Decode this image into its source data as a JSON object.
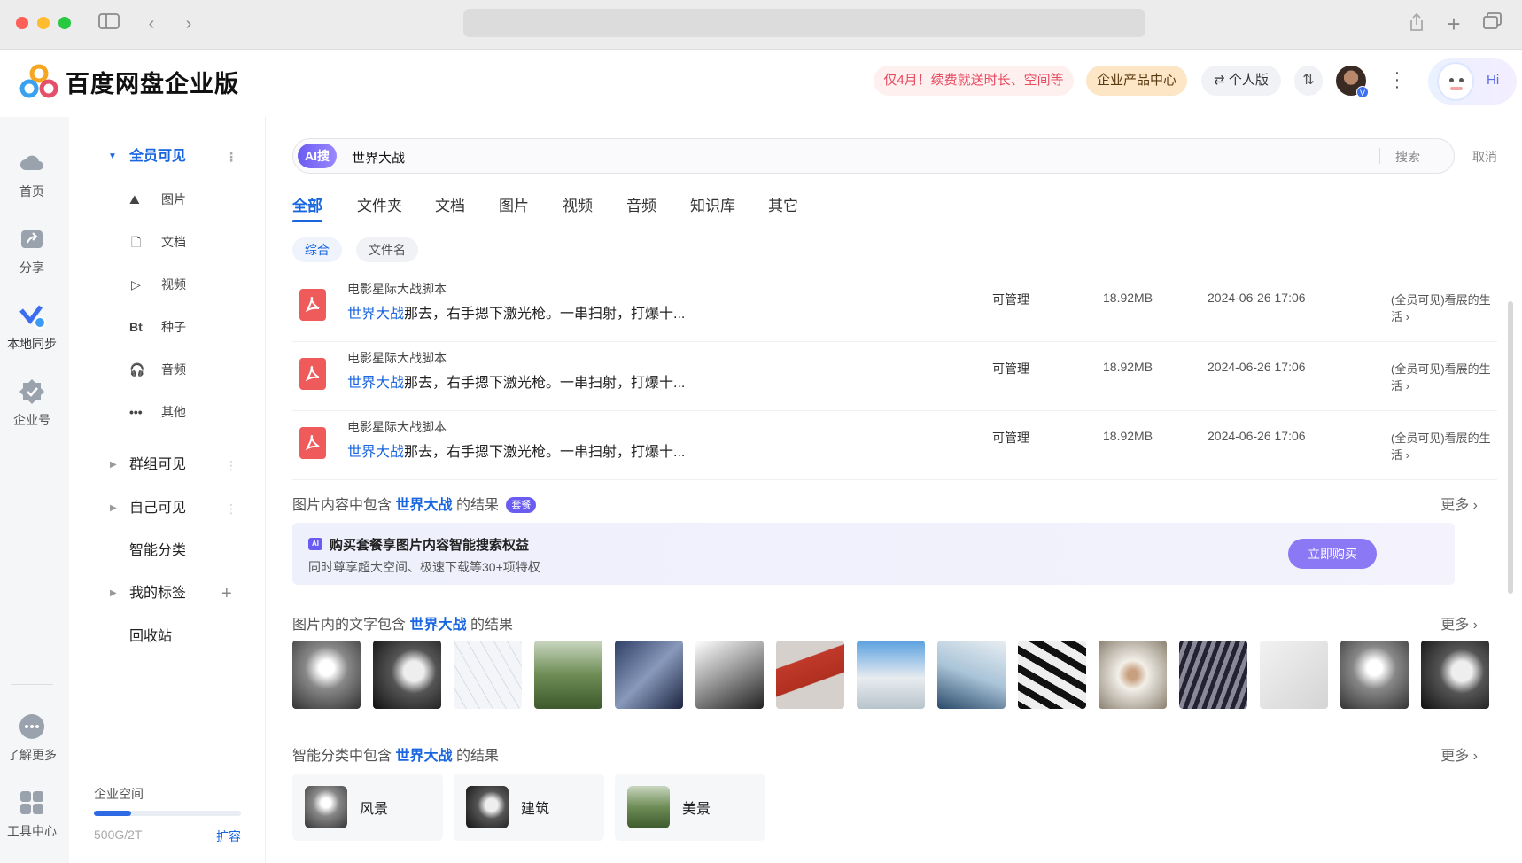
{
  "brand": {
    "name": "百度网盘企业版"
  },
  "header": {
    "promo": "仅4月！续费就送时长、空间等",
    "product_center": "企业产品中心",
    "personal": "个人版",
    "hi": "Hi"
  },
  "leftnav": [
    {
      "label": "首页"
    },
    {
      "label": "分享"
    },
    {
      "label": "本地同步"
    },
    {
      "label": "企业号"
    },
    {
      "label": "了解更多"
    },
    {
      "label": "工具中心"
    }
  ],
  "tree": {
    "all_visible": "全员可见",
    "subitems": [
      {
        "label": "图片"
      },
      {
        "label": "文档"
      },
      {
        "label": "视频"
      },
      {
        "label": "种子",
        "icon": "Bt"
      },
      {
        "label": "音频"
      },
      {
        "label": "其他"
      }
    ],
    "group_visible": "群组可见",
    "self_visible": "自己可见",
    "smart_category": "智能分类",
    "my_tags": "我的标签",
    "recycle": "回收站",
    "storage_label": "企业空间",
    "storage_value": "500G/2T",
    "storage_fraction": 0.25,
    "expand": "扩容"
  },
  "search": {
    "ai_badge": "AI搜",
    "query": "世界大战",
    "search_btn": "搜索",
    "cancel": "取消"
  },
  "tabs": [
    "全部",
    "文件夹",
    "文档",
    "图片",
    "视频",
    "音频",
    "知识库",
    "其它"
  ],
  "chips": [
    "综合",
    "文件名"
  ],
  "files": [
    {
      "title": "电影星际大战脚本",
      "hl": "世界大战",
      "snippet": "那去，右手摁下激光枪。一串扫射，打爆十...",
      "perm": "可管理",
      "size": "18.92MB",
      "date": "2024-06-26 17:06",
      "loc": "(全员可见)看展的生活"
    },
    {
      "title": "电影星际大战脚本",
      "hl": "世界大战",
      "snippet": "那去，右手摁下激光枪。一串扫射，打爆十...",
      "perm": "可管理",
      "size": "18.92MB",
      "date": "2024-06-26 17:06",
      "loc": "(全员可见)看展的生活"
    },
    {
      "title": "电影星际大战脚本",
      "hl": "世界大战",
      "snippet": "那去，右手摁下激光枪。一串扫射，打爆十...",
      "perm": "可管理",
      "size": "18.92MB",
      "date": "2024-06-26 17:06",
      "loc": "(全员可见)看展的生活"
    }
  ],
  "img_content": {
    "pre": "图片内容中包含",
    "kw": "世界大战",
    "post": "的结果",
    "badge": "套餐",
    "more": "更多",
    "promo_title": "购买套餐享图片内容智能搜索权益",
    "promo_sub": "同时尊享超大空间、极速下载等30+项特权",
    "buy": "立即购买"
  },
  "img_text": {
    "pre": "图片内的文字包含",
    "kw": "世界大战",
    "post": "的结果",
    "more": "更多"
  },
  "smart": {
    "pre": "智能分类中包含",
    "kw": "世界大战",
    "post": "的结果",
    "more": "更多",
    "cats": [
      {
        "label": "风景"
      },
      {
        "label": "建筑"
      },
      {
        "label": "美景"
      }
    ]
  },
  "colors": {
    "accent": "#1a66e0",
    "purple": "#7b6cf0"
  }
}
